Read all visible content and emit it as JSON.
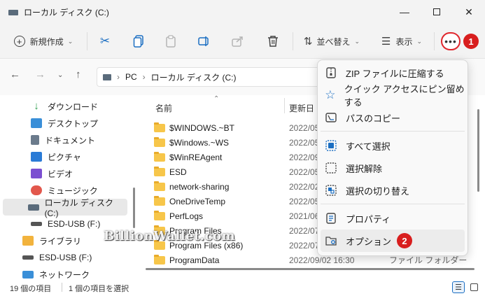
{
  "window": {
    "title": "ローカル ディスク (C:)"
  },
  "toolbar": {
    "new_label": "新規作成",
    "sort_label": "並べ替え",
    "view_label": "表示"
  },
  "badges": {
    "more": "1",
    "options": "2"
  },
  "address": {
    "segments": [
      "PC",
      "ローカル ディスク (C:)"
    ]
  },
  "sidebar": {
    "items": [
      {
        "label": "ダウンロード",
        "icon": "download-icon",
        "color": "#2e9e4f"
      },
      {
        "label": "デスクトップ",
        "icon": "desktop-icon",
        "color": "#3a8fd8"
      },
      {
        "label": "ドキュメント",
        "icon": "document-icon",
        "color": "#6b7b8c"
      },
      {
        "label": "ピクチャ",
        "icon": "picture-icon",
        "color": "#2a7bd6"
      },
      {
        "label": "ビデオ",
        "icon": "video-icon",
        "color": "#7b4fd1"
      },
      {
        "label": "ミュージック",
        "icon": "music-icon",
        "color": "#e2574c"
      },
      {
        "label": "ローカル ディスク (C:)",
        "icon": "drive-icon",
        "color": "#5a6b7b",
        "selected": true
      },
      {
        "label": "ESD-USB (F:)",
        "icon": "usb-drive-icon",
        "color": "#555555"
      },
      {
        "label": "ライブラリ",
        "icon": "library-icon",
        "color": "#f2b33d"
      },
      {
        "label": "ESD-USB (F:)",
        "icon": "usb-drive-icon",
        "color": "#555555"
      },
      {
        "label": "ネットワーク",
        "icon": "network-icon",
        "color": "#3a8fd8"
      }
    ]
  },
  "columns": {
    "name": "名前",
    "date": "更新日"
  },
  "files": [
    {
      "name": "$WINDOWS.~BT",
      "date": "2022/05"
    },
    {
      "name": "$Windows.~WS",
      "date": "2022/05"
    },
    {
      "name": "$WinREAgent",
      "date": "2022/09"
    },
    {
      "name": "ESD",
      "date": "2022/05"
    },
    {
      "name": "network-sharing",
      "date": "2022/02"
    },
    {
      "name": "OneDriveTemp",
      "date": "2022/05"
    },
    {
      "name": "PerfLogs",
      "date": "2021/06"
    },
    {
      "name": "Program Files",
      "date": "2022/07"
    },
    {
      "name": "Program Files (x86)",
      "date": "2022/07"
    },
    {
      "name": "ProgramData",
      "date": "2022/09/02 16:30",
      "type": "ファイル フォルダー"
    }
  ],
  "menu": {
    "items": [
      {
        "label": "ZIP ファイルに圧縮する",
        "icon": "zip-icon"
      },
      {
        "label": "クイック アクセスにピン留めする",
        "icon": "star-icon"
      },
      {
        "label": "パスのコピー",
        "icon": "copy-path-icon"
      },
      {
        "label": "すべて選択",
        "icon": "select-all-icon"
      },
      {
        "label": "選択解除",
        "icon": "select-none-icon"
      },
      {
        "label": "選択の切り替え",
        "icon": "invert-selection-icon"
      },
      {
        "label": "プロパティ",
        "icon": "properties-icon"
      },
      {
        "label": "オプション",
        "icon": "options-icon",
        "highlighted": true
      }
    ]
  },
  "status": {
    "count": "19 個の項目",
    "selected": "1 個の項目を選択"
  },
  "watermark": "BillionWallet.com"
}
